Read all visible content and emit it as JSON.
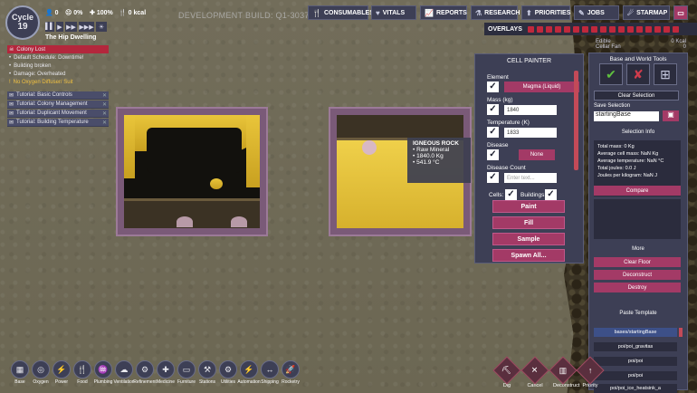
{
  "hud": {
    "cycle_label": "Cycle",
    "cycle_num": "19",
    "dupes": "0",
    "stress": "0%",
    "health": "100%",
    "calories": "0 kcal",
    "dev_build": "DEVELOPMENT BUILD: Q1-303707",
    "colony": "The Hip Dwelling"
  },
  "topbar": [
    {
      "label": "CONSUMABLES",
      "icon": "🍴"
    },
    {
      "label": "VITALS",
      "icon": "♥"
    },
    {
      "label": "REPORTS",
      "icon": "📈"
    },
    {
      "label": "RESEARCH",
      "icon": "⚗"
    },
    {
      "label": "PRIORITIES",
      "icon": "⬆"
    },
    {
      "label": "JOBS",
      "icon": "✎"
    },
    {
      "label": "STARMAP",
      "icon": "☄"
    }
  ],
  "speed": [
    "▌▌",
    "▶",
    "▶▶",
    "▶▶▶",
    "☀"
  ],
  "alerts": [
    {
      "text": "Colony Lost",
      "kind": "red"
    },
    {
      "text": "Default Schedule: Downtime!",
      "kind": "dot"
    },
    {
      "text": "Building broken",
      "kind": "dot"
    },
    {
      "text": "Damage: Overheated",
      "kind": "dot"
    },
    {
      "text": "No Oxygen Diffuser/ Suit",
      "kind": "warn"
    }
  ],
  "tutorials": [
    "Tutorial: Basic Controls",
    "Tutorial: Colony Management",
    "Tutorial: Duplicant Movement",
    "Tutorial: Building Temperature"
  ],
  "overlays_label": "OVERLAYS",
  "resources": [
    {
      "name": "Edible",
      "value": "0 Kcal"
    },
    {
      "name": "Cellar Fan",
      "value": "0"
    }
  ],
  "cell_painter": {
    "title": "CELL PAINTER",
    "element_label": "Element",
    "element_value": "Magma (Liquid)",
    "mass_label": "Mass (kg)",
    "mass_value": "1840",
    "temp_label": "Temperature (K)",
    "temp_value": "1833",
    "disease_label": "Disease",
    "disease_value": "None",
    "disease_count_label": "Disease Count",
    "disease_count_placeholder": "Enter text...",
    "cells_label": "Cells:",
    "buildings_label": "Buildings:",
    "buttons": [
      "Paint",
      "Fill",
      "Sample",
      "Spawn All..."
    ]
  },
  "tooltip": {
    "title": "IGNEOUS ROCK",
    "line1": "Raw Mineral",
    "line2": "1840.0 Kg",
    "line3": "541.9 °C"
  },
  "base_tools": {
    "title": "Base and World Tools",
    "clear_selection": "Clear Selection",
    "save_selection": "Save Selection",
    "save_name": "startingBase",
    "selection_info": "Selection Info",
    "info": [
      "Total mass: 0 Kg",
      "Average cell mass: NaN Kg",
      "Average temperature: NaN °C",
      "Total joules: 0.0 J",
      "Joules per kilogram: NaN J"
    ],
    "compare": "Compare",
    "more": "More",
    "more_buttons": [
      "Clear Floor",
      "Deconstruct",
      "Destroy"
    ],
    "paste_template": "Paste Template",
    "templates": [
      "bases/startingBase",
      "poi/poi_gravitas",
      "poi/poi",
      "poi/poi",
      "poi/poi_ice_heatsink_a"
    ]
  },
  "build_menu": [
    "Base",
    "Oxygen",
    "Power",
    "Food",
    "Plumbing",
    "Ventilation",
    "Refinement",
    "Medicine",
    "Furniture",
    "Stations",
    "Utilities",
    "Automation",
    "Shipping",
    "Rocketry"
  ],
  "build_icons": [
    "▦",
    "◎",
    "⚡",
    "🍴",
    "♒",
    "☁",
    "⚙",
    "✚",
    "▭",
    "⚒",
    "⚙",
    "⚡",
    "↔",
    "🚀"
  ],
  "tools": [
    "Dig",
    "Cancel",
    "Deconstruct",
    "Priority"
  ]
}
